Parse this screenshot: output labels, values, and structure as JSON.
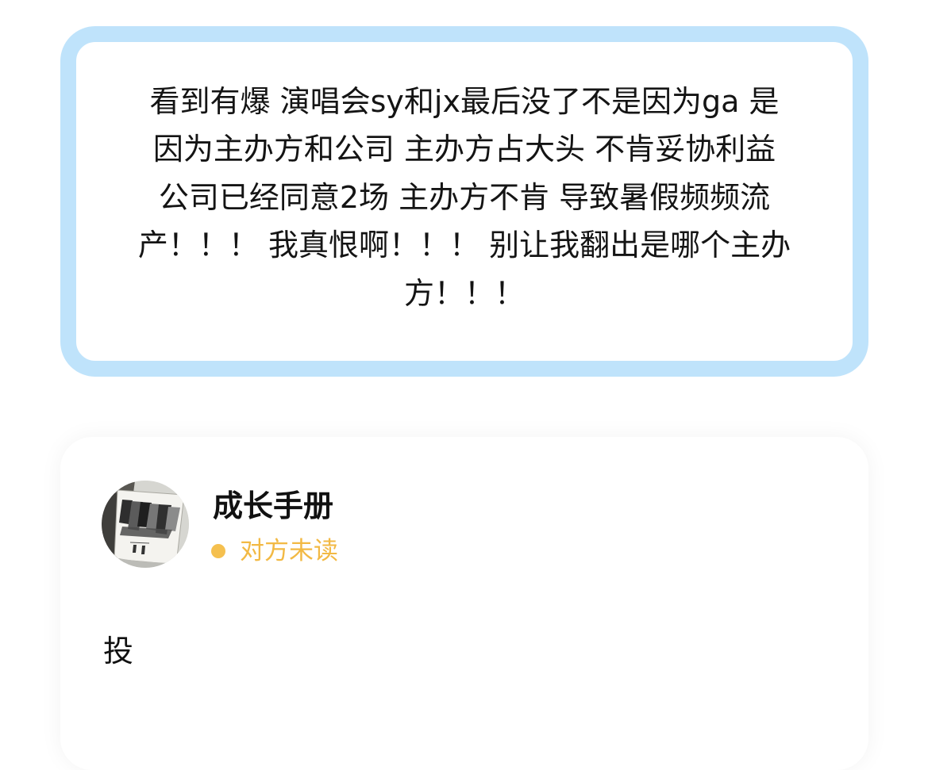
{
  "post": {
    "text": "看到有爆 演唱会sy和jx最后没了不是因为ga 是\n因为主办方和公司 主办方占大头 不肯妥协利益\n公司已经同意2场 主办方不肯 导致暑假频频流\n产！！！ 我真恨啊！！！ 别让我翻出是哪个主办\n方！！！",
    "accent_color": "#bfe3fb"
  },
  "message": {
    "sender": {
      "avatar_icon": "book-cover-avatar",
      "name": "成长手册"
    },
    "status": {
      "text": "对方未读",
      "color": "#f5c04f"
    },
    "body": "投"
  }
}
